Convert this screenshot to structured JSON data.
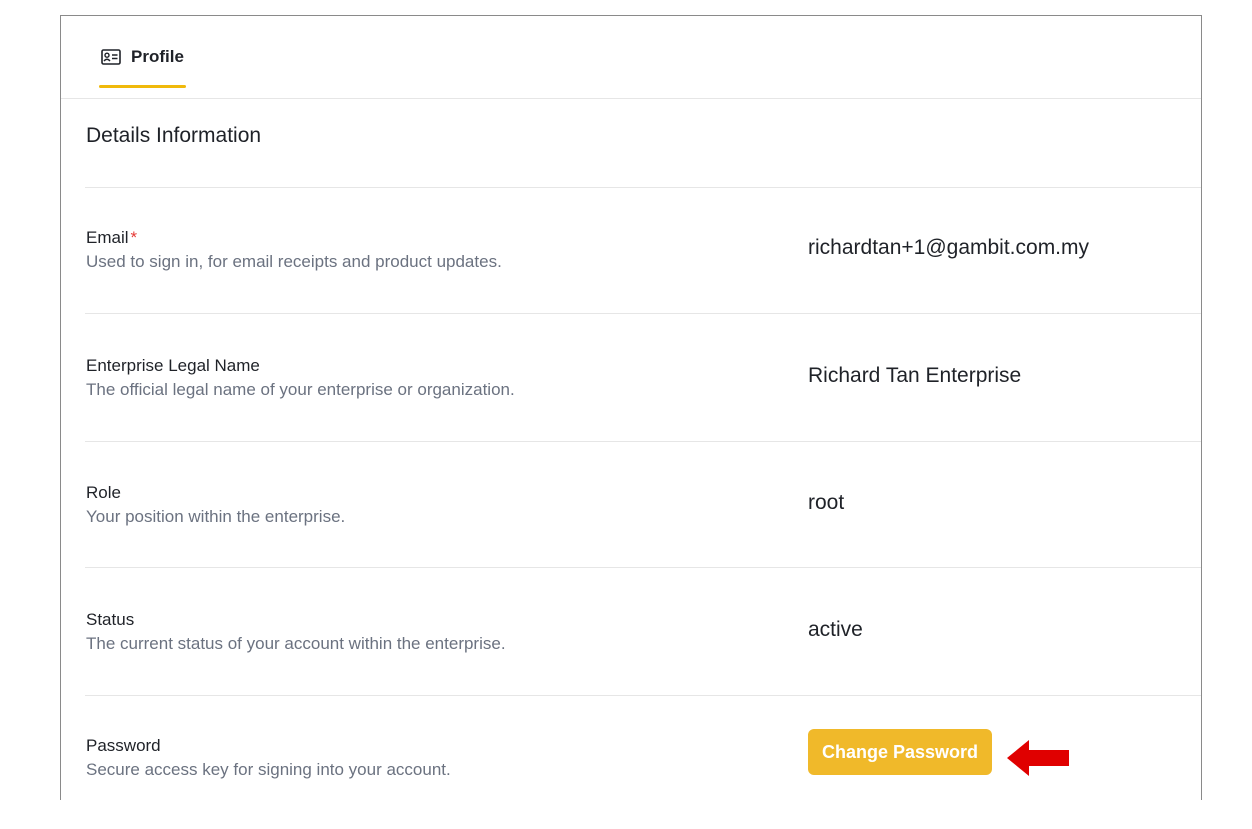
{
  "tabs": [
    {
      "label": "Profile",
      "icon": "id-card-icon",
      "active": true
    }
  ],
  "section": {
    "title": "Details Information"
  },
  "fields": {
    "email": {
      "label": "Email",
      "required_mark": "*",
      "description": "Used to sign in, for email receipts and product updates.",
      "value": "richardtan+1@gambit.com.my"
    },
    "enterprise": {
      "label": "Enterprise Legal Name",
      "description": "The official legal name of your enterprise or organization.",
      "value": "Richard Tan Enterprise"
    },
    "role": {
      "label": "Role",
      "description": "Your position within the enterprise.",
      "value": "root"
    },
    "status": {
      "label": "Status",
      "description": "The current status of your account within the enterprise.",
      "value": "active"
    },
    "password": {
      "label": "Password",
      "description": "Secure access key for signing into your account.",
      "button_label": "Change Password"
    }
  },
  "colors": {
    "accent": "#f0b90b",
    "button": "#f0b92a",
    "required": "#e53935",
    "annotation_arrow": "#e00000"
  },
  "annotation": {
    "icon": "arrow-left-icon"
  }
}
